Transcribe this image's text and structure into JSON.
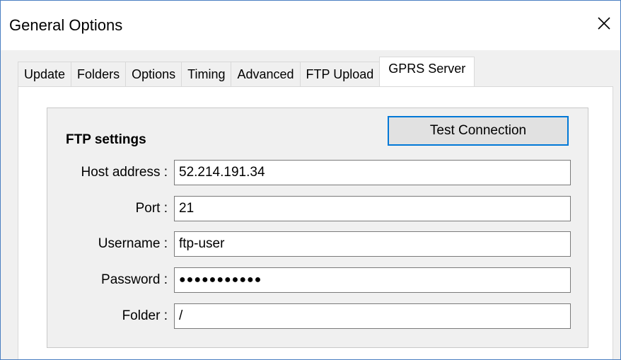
{
  "window": {
    "title": "General Options",
    "close_icon": "close-icon"
  },
  "tabs": [
    {
      "label": "Update",
      "active": false
    },
    {
      "label": "Folders",
      "active": false
    },
    {
      "label": "Options",
      "active": false
    },
    {
      "label": "Timing",
      "active": false
    },
    {
      "label": "Advanced",
      "active": false
    },
    {
      "label": "FTP Upload",
      "active": false
    },
    {
      "label": "GPRS Server",
      "active": true
    }
  ],
  "ftp": {
    "group_title": "FTP settings",
    "test_button": "Test Connection",
    "fields": {
      "host": {
        "label": "Host address :",
        "value": "52.214.191.34"
      },
      "port": {
        "label": "Port :",
        "value": "21"
      },
      "username": {
        "label": "Username :",
        "value": "ftp-user"
      },
      "password": {
        "label": "Password :",
        "value": "●●●●●●●●●●●"
      },
      "folder": {
        "label": "Folder :",
        "value": "/"
      }
    }
  },
  "colors": {
    "accent": "#0078d7",
    "dialog_bg": "#f0f0f0",
    "window_border": "#4a7fc1"
  }
}
